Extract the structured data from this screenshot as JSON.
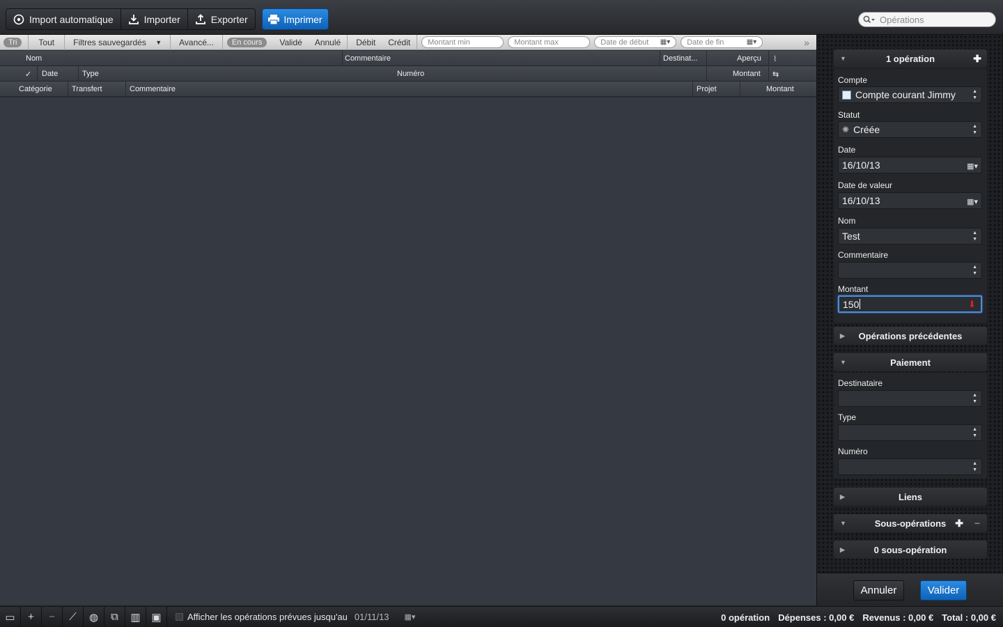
{
  "toolbar": {
    "import_auto": "Import automatique",
    "import": "Importer",
    "export": "Exporter",
    "print": "Imprimer",
    "search_placeholder": "Opérations"
  },
  "filters": {
    "sort": "Tri",
    "all": "Tout",
    "saved": "Filtres sauvegardés",
    "advanced": "Avancé...",
    "pending": "En cours",
    "validated": "Validé",
    "cancelled": "Annulé",
    "debit": "Débit",
    "credit": "Crédit",
    "amount_min": "Montant min",
    "amount_max": "Montant max",
    "date_start": "Date de début",
    "date_end": "Date de fin"
  },
  "columns": {
    "row1": {
      "name": "Nom",
      "comment": "Commentaire",
      "recipient": "Destinat...",
      "preview": "Aperçu"
    },
    "row2": {
      "check": "✓",
      "date": "Date",
      "type": "Type",
      "number": "Numéro",
      "amount": "Montant"
    },
    "row3": {
      "category": "Catégorie",
      "transfer": "Transfert",
      "comment": "Commentaire",
      "project": "Projet",
      "amount": "Montant"
    }
  },
  "inspector": {
    "header": "1 opération",
    "account_label": "Compte",
    "account_value": "Compte courant Jimmy",
    "status_label": "Statut",
    "status_value": "Créée",
    "date_label": "Date",
    "date_value": "16/10/13",
    "value_date_label": "Date de valeur",
    "value_date_value": "16/10/13",
    "name_label": "Nom",
    "name_value": "Test",
    "comment_label": "Commentaire",
    "comment_value": "",
    "amount_label": "Montant",
    "amount_value": "150",
    "previous_ops": "Opérations précédentes",
    "payment": "Paiement",
    "recipient_label": "Destinataire",
    "type_label": "Type",
    "number_label": "Numéro",
    "links": "Liens",
    "sub_ops": "Sous-opérations",
    "sub_ops_count": "0 sous-opération",
    "cancel": "Annuler",
    "validate": "Valider"
  },
  "statusbar": {
    "show_planned": "Afficher les opérations prévues jusqu'au",
    "planned_date": "01/11/13",
    "count": "0 opération",
    "expenses": "Dépenses : 0,00 €",
    "income": "Revenus : 0,00 €",
    "total": "Total : 0,00 €"
  },
  "colors": {
    "accent": "#1a73cc",
    "amount_indicator": "#e02020"
  }
}
